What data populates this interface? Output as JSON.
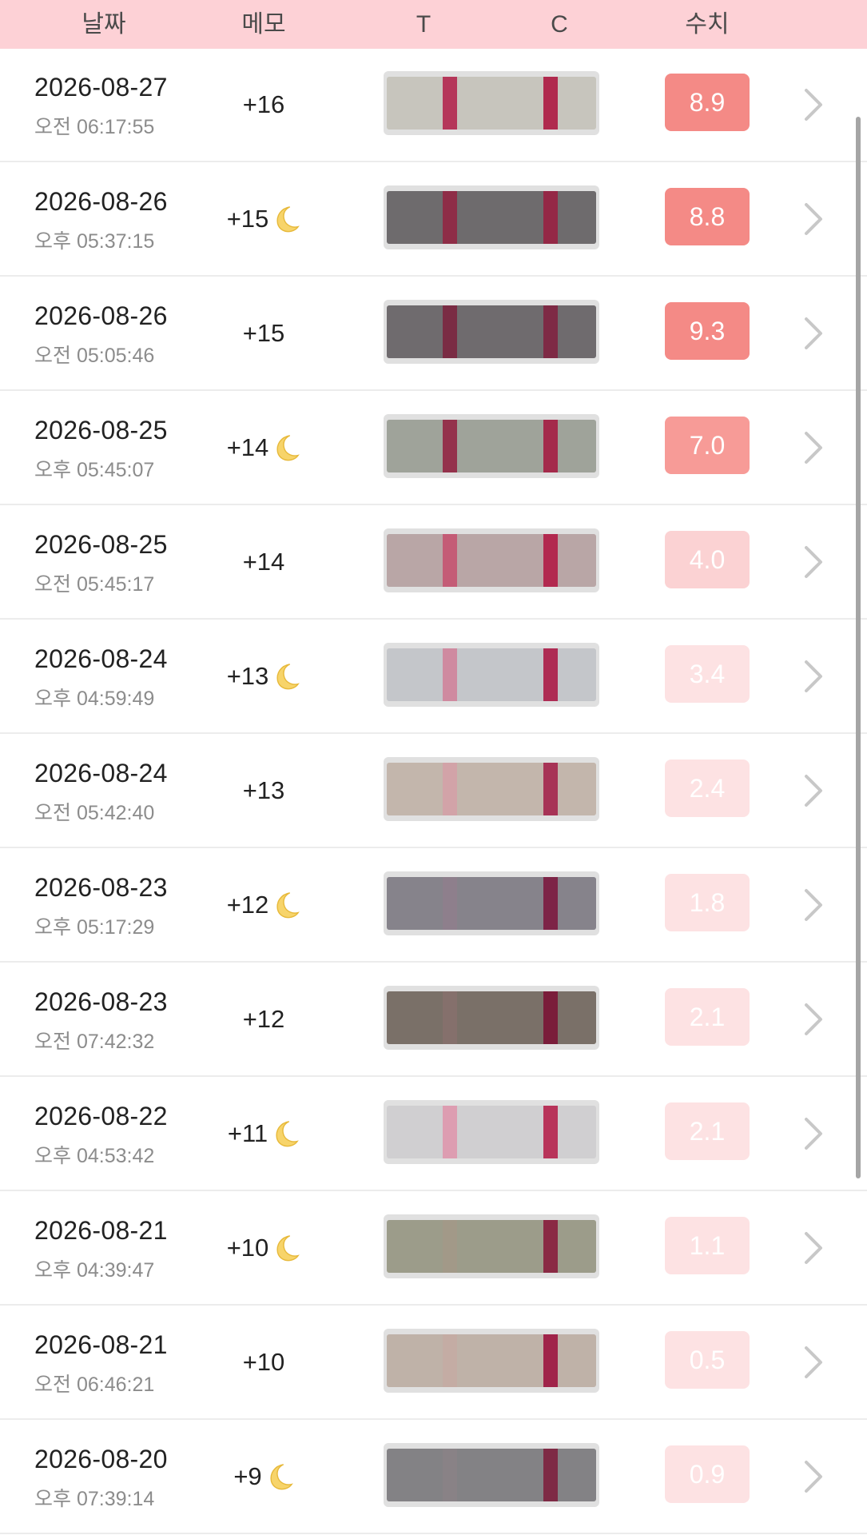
{
  "header": {
    "col_date": "날짜",
    "col_memo": "메모",
    "col_t": "T",
    "col_c": "C",
    "col_value": "수치"
  },
  "icons": {
    "moon": "crescent-moon-icon",
    "chevron": "chevron-right-icon"
  },
  "colors": {
    "header_bg": "#fdd1d6",
    "value_high": "#f48a86",
    "value_mid": "#f79b97",
    "value_low": "#fde2e3",
    "line_red": "#b02a4e"
  },
  "rows": [
    {
      "date": "2026-08-27",
      "time": "오전 06:17:55",
      "memo": "+16",
      "moon": false,
      "value": "8.9",
      "strip_bg": "#c7c5bd",
      "t_color": "#b5375a",
      "c_color": "#b02a4e"
    },
    {
      "date": "2026-08-26",
      "time": "오후 05:37:15",
      "memo": "+15",
      "moon": true,
      "value": "8.8",
      "strip_bg": "#6e6b6d",
      "t_color": "#8e2d47",
      "c_color": "#942846"
    },
    {
      "date": "2026-08-26",
      "time": "오전 05:05:46",
      "memo": "+15",
      "moon": false,
      "value": "9.3",
      "strip_bg": "#6f6b6e",
      "t_color": "#7a2c44",
      "c_color": "#7e2a45"
    },
    {
      "date": "2026-08-25",
      "time": "오후 05:45:07",
      "memo": "+14",
      "moon": true,
      "value": "7.0",
      "strip_bg": "#9fa39a",
      "t_color": "#94324c",
      "c_color": "#a42a4b"
    },
    {
      "date": "2026-08-25",
      "time": "오전 05:45:17",
      "memo": "+14",
      "moon": false,
      "value": "4.0",
      "strip_bg": "#b9a6a6",
      "t_color": "#c45c76",
      "c_color": "#b2294f"
    },
    {
      "date": "2026-08-24",
      "time": "오후 04:59:49",
      "memo": "+13",
      "moon": true,
      "value": "3.4",
      "strip_bg": "#c4c6ca",
      "t_color": "#cf8aa0",
      "c_color": "#ae2c54"
    },
    {
      "date": "2026-08-24",
      "time": "오전 05:42:40",
      "memo": "+13",
      "moon": false,
      "value": "2.4",
      "strip_bg": "#c3b6ac",
      "t_color": "#d2a3a8",
      "c_color": "#a73356"
    },
    {
      "date": "2026-08-23",
      "time": "오후 05:17:29",
      "memo": "+12",
      "moon": true,
      "value": "1.8",
      "strip_bg": "#86838b",
      "t_color": "#8e7f8c",
      "c_color": "#7d2447"
    },
    {
      "date": "2026-08-23",
      "time": "오전 07:42:32",
      "memo": "+12",
      "moon": false,
      "value": "2.1",
      "strip_bg": "#7a7068",
      "t_color": "#85706c",
      "c_color": "#7a1d3a"
    },
    {
      "date": "2026-08-22",
      "time": "오후 04:53:42",
      "memo": "+11",
      "moon": true,
      "value": "2.1",
      "strip_bg": "#d0cfd1",
      "t_color": "#dd9db1",
      "c_color": "#b8345a"
    },
    {
      "date": "2026-08-21",
      "time": "오후 04:39:47",
      "memo": "+10",
      "moon": true,
      "value": "1.1",
      "strip_bg": "#9c9c8a",
      "t_color": "#a29988",
      "c_color": "#8a2a44"
    },
    {
      "date": "2026-08-21",
      "time": "오전 06:46:21",
      "memo": "+10",
      "moon": false,
      "value": "0.5",
      "strip_bg": "#bfb2a8",
      "t_color": "#c4aca4",
      "c_color": "#a0244a"
    },
    {
      "date": "2026-08-20",
      "time": "오후 07:39:14",
      "memo": "+9",
      "moon": true,
      "value": "0.9",
      "strip_bg": "#838285",
      "t_color": "#898286",
      "c_color": "#7e2a45"
    }
  ]
}
